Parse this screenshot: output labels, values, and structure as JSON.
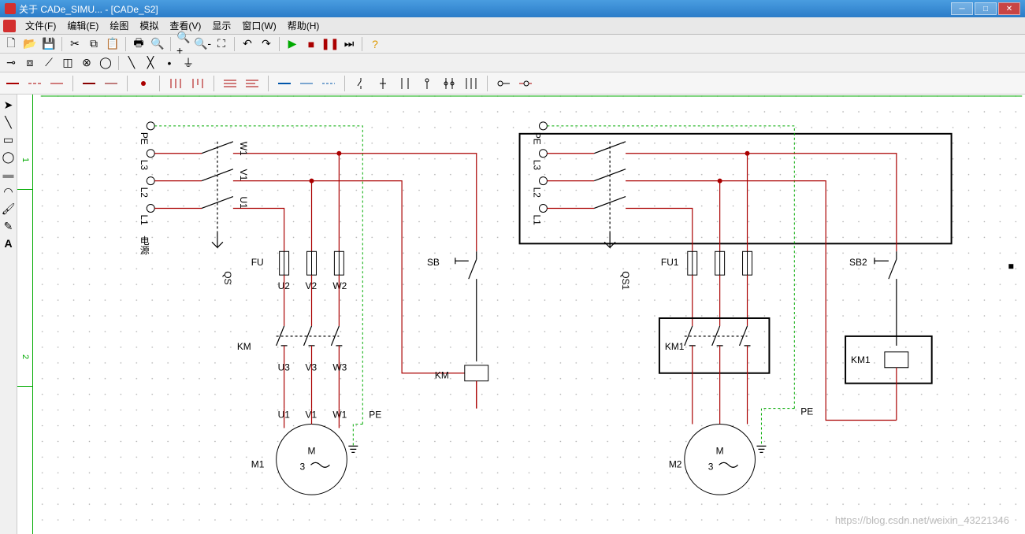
{
  "window": {
    "title": "关于 CADe_SIMU... - [CADe_S2]"
  },
  "menu": {
    "file": "文件(F)",
    "edit": "编辑(E)",
    "draw": "绘图",
    "sim": "模拟",
    "view": "查看(V)",
    "display": "显示",
    "window": "窗口(W)",
    "help": "帮助(H)"
  },
  "ruler": {
    "n1": "1",
    "n2": "2"
  },
  "labels": {
    "PE": "PE",
    "L3": "L3",
    "L2": "L2",
    "L1": "L1",
    "supply": "电源",
    "W1": "W1",
    "V1": "V1",
    "U1": "U1",
    "QS": "QS",
    "FU": "FU",
    "SB": "SB",
    "U2": "U2",
    "V2": "V2",
    "W2": "W2",
    "KM": "KM",
    "U3": "U3",
    "V3": "V3",
    "W3": "W3",
    "U1b": "U1",
    "V1b": "V1",
    "W1b": "W1",
    "M1": "M1",
    "M": "M",
    "three": "3",
    "QS1": "QS1",
    "FU1": "FU1",
    "SB2": "SB2",
    "KM1": "KM1",
    "M2": "M2"
  },
  "watermark": "https://blog.csdn.net/weixin_43221346",
  "chart_data": {
    "type": "diagram",
    "description": "Electrical control schematic (CADe_SIMU)",
    "circuits": [
      {
        "id": "left",
        "supply": [
          "PE",
          "L3",
          "L2",
          "L1"
        ],
        "disconnect": {
          "ref": "QS",
          "terminals_top": [
            "W1",
            "V1",
            "U1"
          ]
        },
        "fuses": {
          "ref": "FU",
          "terminals_bottom": [
            "U2",
            "V2",
            "W2"
          ]
        },
        "contactor_main": {
          "ref": "KM",
          "terminals_bottom": [
            "U3",
            "V3",
            "W3"
          ]
        },
        "motor": {
          "ref": "M1",
          "type": "M 3~",
          "terminals": [
            "U1",
            "V1",
            "W1",
            "PE"
          ]
        },
        "control": {
          "pushbutton": "SB",
          "coil": "KM"
        }
      },
      {
        "id": "right",
        "supply": [
          "PE",
          "L3",
          "L2",
          "L1"
        ],
        "disconnect": {
          "ref": "QS1"
        },
        "fuses": {
          "ref": "FU1"
        },
        "contactor_main": {
          "ref": "KM1"
        },
        "motor": {
          "ref": "M2",
          "type": "M 3~",
          "terminals": [
            "PE"
          ]
        },
        "control": {
          "pushbutton": "SB2",
          "coil": "KM1"
        },
        "selection_boxes": [
          "supply_block",
          "KM1_main",
          "KM1_coil"
        ]
      }
    ]
  }
}
